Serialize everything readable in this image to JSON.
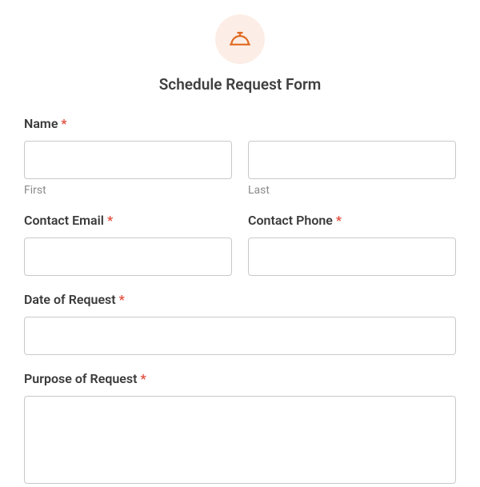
{
  "header": {
    "icon": "service-bell-icon",
    "title": "Schedule Request Form"
  },
  "fields": {
    "name": {
      "label": "Name",
      "required": "*",
      "first_sublabel": "First",
      "last_sublabel": "Last",
      "first_value": "",
      "last_value": ""
    },
    "email": {
      "label": "Contact Email",
      "required": "*",
      "value": ""
    },
    "phone": {
      "label": "Contact Phone",
      "required": "*",
      "value": ""
    },
    "date": {
      "label": "Date of Request",
      "required": "*",
      "value": ""
    },
    "purpose": {
      "label": "Purpose of Request",
      "required": "*",
      "value": ""
    }
  }
}
